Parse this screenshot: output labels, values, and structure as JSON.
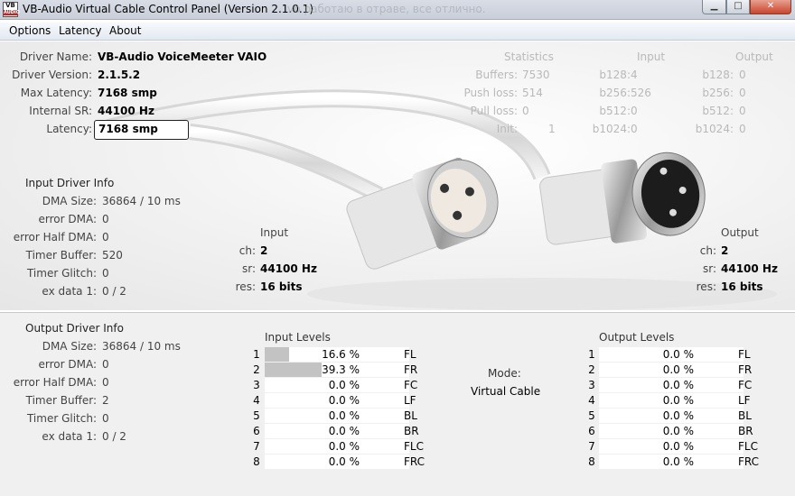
{
  "window": {
    "title": "VB-Audio Virtual Cable Control Panel (Version 2.1.0.1)",
    "background_title_fragment": "vb работаю в отраве, все отлично.",
    "icon_text_top": "VB",
    "icon_text_bottom": "AUDIO",
    "min_glyph": "▁",
    "max_glyph": "□",
    "close_glyph": "✕"
  },
  "menu": [
    "Options",
    "Latency",
    "About"
  ],
  "driver": {
    "name_label": "Driver Name:",
    "name": "VB-Audio VoiceMeeter VAIO",
    "version_label": "Driver Version:",
    "version": "2.1.5.2",
    "max_latency_label": "Max Latency:",
    "max_latency": "7168 smp",
    "internal_sr_label": "Internal SR:",
    "internal_sr": "44100 Hz",
    "latency_label": "Latency:",
    "latency": "7168 smp"
  },
  "statistics": {
    "header": "Statistics",
    "input_header": "Input",
    "output_header": "Output",
    "rows": [
      {
        "label": "Buffers:",
        "value": "7530",
        "in_label": "b128:",
        "in_value": "4",
        "out_label": "b128:",
        "out_value": "0"
      },
      {
        "label": "Push loss:",
        "value": "514",
        "in_label": "b256:",
        "in_value": "526",
        "out_label": "b256:",
        "out_value": "0"
      },
      {
        "label": "Pull loss:",
        "value": "0",
        "in_label": "b512:",
        "in_value": "0",
        "out_label": "b512:",
        "out_value": "0"
      },
      {
        "label": "Init:",
        "value": "1",
        "in_label": "b1024:",
        "in_value": "0",
        "out_label": "b1024:",
        "out_value": "0"
      }
    ]
  },
  "input_driver_info": {
    "title": "Input Driver Info",
    "rows": [
      {
        "label": "DMA Size:",
        "value": "36864 / 10 ms"
      },
      {
        "label": "error DMA:",
        "value": "0"
      },
      {
        "label": "error Half DMA:",
        "value": "0"
      },
      {
        "label": "Timer Buffer:",
        "value": "520"
      },
      {
        "label": "Timer Glitch:",
        "value": "0"
      },
      {
        "label": "ex data 1:",
        "value": "0 / 2"
      }
    ]
  },
  "input_format": {
    "title": "Input",
    "ch_label": "ch:",
    "ch": "2",
    "sr_label": "sr:",
    "sr": "44100 Hz",
    "res_label": "res:",
    "res": "16 bits"
  },
  "output_format": {
    "title": "Output",
    "ch_label": "ch:",
    "ch": "2",
    "sr_label": "sr:",
    "sr": "44100 Hz",
    "res_label": "res:",
    "res": "16 bits"
  },
  "output_driver_info": {
    "title": "Output Driver Info",
    "rows": [
      {
        "label": "DMA Size:",
        "value": "36864 / 10 ms"
      },
      {
        "label": "error DMA:",
        "value": "0"
      },
      {
        "label": "error Half DMA:",
        "value": "0"
      },
      {
        "label": "Timer Buffer:",
        "value": "2"
      },
      {
        "label": "Timer Glitch:",
        "value": "0"
      },
      {
        "label": "ex data 1:",
        "value": "0 / 2"
      }
    ]
  },
  "input_levels": {
    "title": "Input Levels",
    "channels": [
      {
        "num": "1",
        "level": 0.166,
        "text": "16.6 %",
        "name": "FL"
      },
      {
        "num": "2",
        "level": 0.393,
        "text": "39.3 %",
        "name": "FR"
      },
      {
        "num": "3",
        "level": 0,
        "text": "0.0 %",
        "name": "FC"
      },
      {
        "num": "4",
        "level": 0,
        "text": "0.0 %",
        "name": "LF"
      },
      {
        "num": "5",
        "level": 0,
        "text": "0.0 %",
        "name": "BL"
      },
      {
        "num": "6",
        "level": 0,
        "text": "0.0 %",
        "name": "BR"
      },
      {
        "num": "7",
        "level": 0,
        "text": "0.0 %",
        "name": "FLC"
      },
      {
        "num": "8",
        "level": 0,
        "text": "0.0 %",
        "name": "FRC"
      }
    ]
  },
  "mode": {
    "label": "Mode:",
    "value": "Virtual Cable"
  },
  "output_levels": {
    "title": "Output Levels",
    "channels": [
      {
        "num": "1",
        "level": 0,
        "text": "0.0 %",
        "name": "FL"
      },
      {
        "num": "2",
        "level": 0,
        "text": "0.0 %",
        "name": "FR"
      },
      {
        "num": "3",
        "level": 0,
        "text": "0.0 %",
        "name": "FC"
      },
      {
        "num": "4",
        "level": 0,
        "text": "0.0 %",
        "name": "LF"
      },
      {
        "num": "5",
        "level": 0,
        "text": "0.0 %",
        "name": "BL"
      },
      {
        "num": "6",
        "level": 0,
        "text": "0.0 %",
        "name": "BR"
      },
      {
        "num": "7",
        "level": 0,
        "text": "0.0 %",
        "name": "FLC"
      },
      {
        "num": "8",
        "level": 0,
        "text": "0.0 %",
        "name": "FRC"
      }
    ]
  },
  "colors": {
    "meter_fill": "#c3c3c3",
    "meter_bg": "#ffffff",
    "stats_text": "#b9b9b9",
    "lower_bg": "#f0f0f0"
  }
}
